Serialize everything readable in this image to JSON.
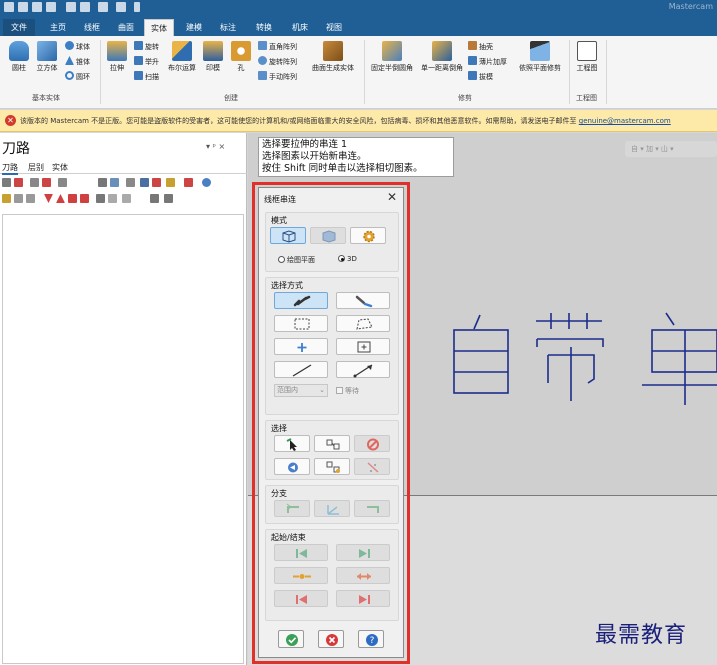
{
  "app": {
    "brand": "Mastercam",
    "quick_access_icons": [
      "new-icon",
      "open-icon",
      "save-icon",
      "save-as-icon",
      "print-icon",
      "export-icon",
      "undo-icon",
      "redo-icon",
      "customize-icon"
    ]
  },
  "ribbon": {
    "tabs": [
      "文件",
      "主页",
      "线框",
      "曲面",
      "实体",
      "建模",
      "标注",
      "转换",
      "机床",
      "视图"
    ],
    "active_tab": "实体",
    "groups": {
      "basic": {
        "label": "基本实体",
        "cylinder": "圆柱",
        "cube": "立方体",
        "sphere": "球体",
        "cone": "锥体",
        "torus": "圆环"
      },
      "create": {
        "label": "创建",
        "extrude": "拉伸",
        "revolve": "旋转",
        "sweep": "扫描",
        "loft": "举升",
        "boolean": "布尔运算",
        "mold": "印模",
        "hole": "孔",
        "rect_array": "直角阵列",
        "rot_array": "旋转阵列",
        "manual_array": "手动阵列",
        "curve_gen": "曲面生成实体"
      },
      "modify": {
        "label": "修剪",
        "fixed_fillet": "固定半倒圆角",
        "chamfer": "单一距离倒角",
        "shell": "抽壳",
        "thicken": "薄片加厚",
        "draft": "拔模",
        "trim_plane": "依照平面修剪"
      },
      "drawing": {
        "label": "工程图",
        "layout": "工程图"
      }
    }
  },
  "warning": {
    "text": "该版本的 Mastercam 不是正版。您可能是盗版软件的受害者，这可能使您的计算机和/或网络面临重大的安全风险，包括病毒、损坏和其他恶意软件。如需帮助，请发送电子邮件至 ",
    "link": "genuine@mastercam.com"
  },
  "left_panel": {
    "title": "刀路",
    "pin": "▾ ᵖ ×",
    "tabs": [
      "刀路",
      "层别",
      "实体"
    ]
  },
  "prompt": {
    "line1": "选择要拉伸的串连 1",
    "line2": "选择图素以开始新串连。",
    "line3": "按住 Shift 同时单击以选择相切图素。"
  },
  "viewport": {
    "toolbar_hint": "自 ▾ 加 ▾ 山 ▾",
    "geometry_strokes": 3
  },
  "dialog": {
    "title": "线框串连",
    "close": "✕",
    "mode": {
      "label": "模式",
      "radio_plane": "绘图平面",
      "radio_3d": "3D",
      "selected": "3D"
    },
    "method": {
      "label": "选择方式",
      "scope": "范围内",
      "wait": "等待"
    },
    "select": {
      "label": "选择"
    },
    "branch": {
      "label": "分支"
    },
    "start_end": {
      "label": "起始/结束"
    }
  },
  "watermark": "最需教育",
  "colors": {
    "ribbon_blue": "#1f5f96",
    "warning_bg": "#fde9a8",
    "highlight_red": "#e0302a",
    "geometry_blue": "#1c2d8c",
    "selected_blue": "#cde3f6"
  }
}
